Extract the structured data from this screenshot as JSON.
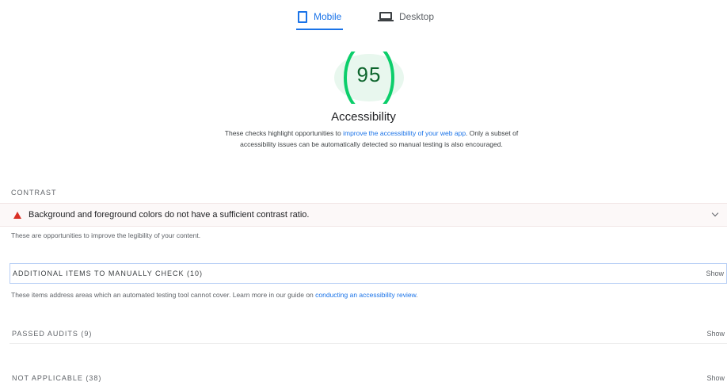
{
  "tabs": {
    "mobile": {
      "label": "Mobile",
      "icon": "phone-icon",
      "active": true
    },
    "desktop": {
      "label": "Desktop",
      "icon": "laptop-icon",
      "active": false
    }
  },
  "gauge": {
    "score": "95",
    "score_fraction": 0.95,
    "color": "#0cce6b",
    "fill": "#e8f7ee"
  },
  "category": {
    "title": "Accessibility",
    "desc_prefix": "These checks highlight opportunities to ",
    "desc_link": "improve the accessibility of your web app",
    "desc_suffix": ". Only a subset of accessibility issues can be automatically detected so manual testing is also encouraged."
  },
  "contrast": {
    "header": "CONTRAST",
    "audit_title": "Background and foreground colors do not have a sufficient contrast ratio.",
    "description": "These are opportunities to improve the legibility of your content.",
    "status_color": "#d93025"
  },
  "manual": {
    "label": "ADDITIONAL ITEMS TO MANUALLY CHECK (10)",
    "show": "Show",
    "desc_prefix": "These items address areas which an automated testing tool cannot cover. Learn more in our guide on ",
    "desc_link": "conducting an accessibility review",
    "desc_suffix": "."
  },
  "passed": {
    "label": "PASSED AUDITS (9)",
    "show": "Show"
  },
  "not_applicable": {
    "label": "NOT APPLICABLE (38)",
    "show": "Show"
  }
}
